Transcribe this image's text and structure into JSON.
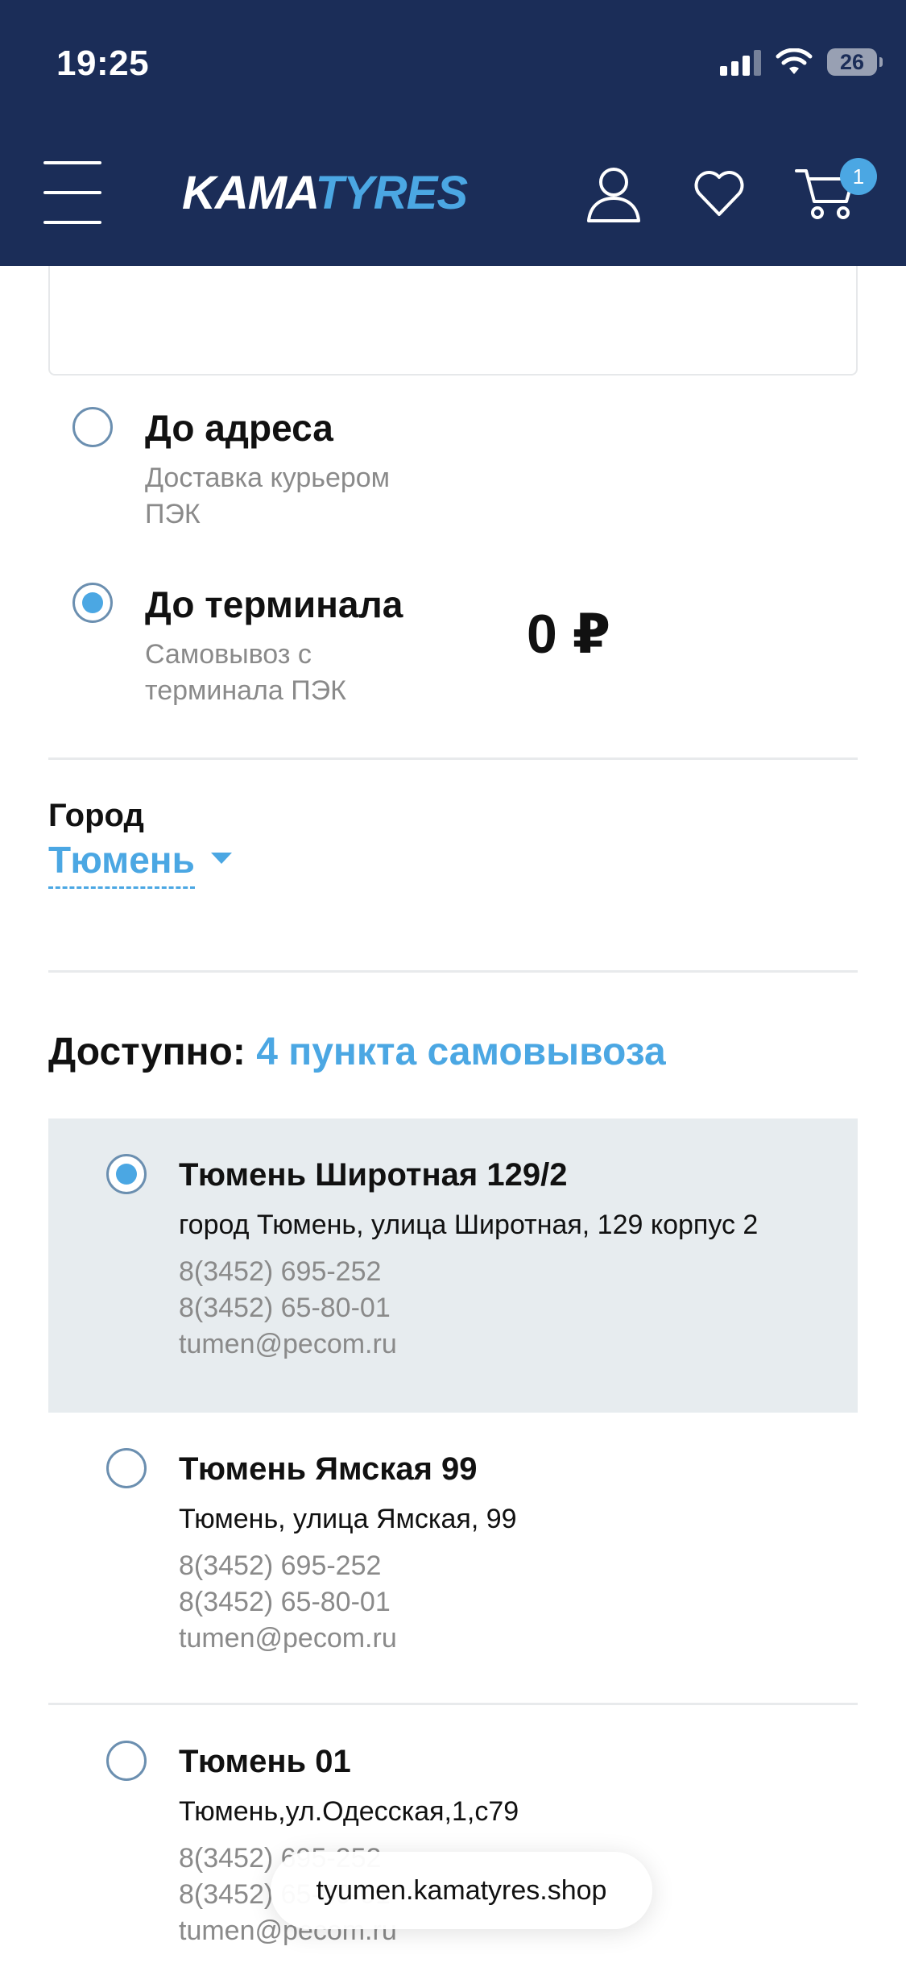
{
  "status_bar": {
    "time": "19:25",
    "battery": "26"
  },
  "header": {
    "logo_part1": "KAMA",
    "logo_part2": "TYRES",
    "cart_count": "1",
    "icons": [
      "menu-icon",
      "user-icon",
      "heart-icon",
      "cart-icon"
    ]
  },
  "delivery_options": [
    {
      "title": "До адреса",
      "subtitle_lines": [
        "Доставка курьером",
        "ПЭК"
      ],
      "selected": false
    },
    {
      "title": "До терминала",
      "subtitle_lines": [
        "Самовывоз с",
        "терминала ПЭК"
      ],
      "selected": true,
      "price": "0 ₽"
    }
  ],
  "city": {
    "label": "Город",
    "value": "Тюмень"
  },
  "available": {
    "label": "Доступно:",
    "count_text": "4 пункта самовывоза"
  },
  "pickup_points": [
    {
      "name": "Тюмень Широтная 129/2",
      "address": "город Тюмень, улица Широтная, 129 корпус 2",
      "phone1": "8(3452) 695-252",
      "phone2": "8(3452) 65-80-01",
      "email": "tumen@pecom.ru",
      "selected": true
    },
    {
      "name": "Тюмень Ямская 99",
      "address": "Тюмень, улица Ямская, 99",
      "phone1": "8(3452) 695-252",
      "phone2": "8(3452) 65-80-01",
      "email": "tumen@pecom.ru",
      "selected": false
    },
    {
      "name": "Тюмень 01",
      "address": "Тюмень,ул.Одесская,1,с79",
      "phone1": "8(3452) 695-252",
      "phone2": "8(3452) 65-80-01",
      "email": "tumen@pecom.ru",
      "selected": false
    }
  ],
  "browser": {
    "url": "tyumen.kamatyres.shop"
  },
  "colors": {
    "header_bg": "#1b2d58",
    "accent": "#4ba7e3",
    "selected_bg": "#e7ecef",
    "muted_text": "#8a8a8a"
  }
}
